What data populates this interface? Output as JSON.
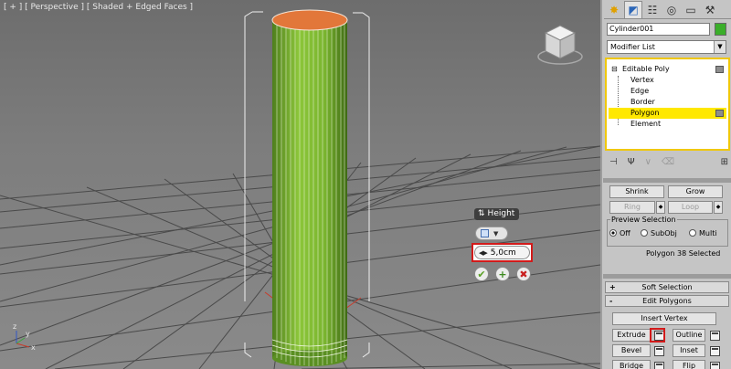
{
  "viewport": {
    "label": "[ + ] [ Perspective ] [ Shaded + Edged Faces ]",
    "axes": {
      "x": "x",
      "y": "y",
      "z": "z"
    }
  },
  "caddy": {
    "title": "Height",
    "value": "5,0cm",
    "mode_icon": "extrude-mode-icon",
    "ok_glyph": "✔",
    "apply_glyph": "+",
    "cancel_glyph": "✖"
  },
  "panel": {
    "tabs": [
      {
        "icon": "create-icon",
        "glyph": "✸"
      },
      {
        "icon": "modify-icon",
        "glyph": "◩"
      },
      {
        "icon": "hierarchy-icon",
        "glyph": "☷"
      },
      {
        "icon": "motion-icon",
        "glyph": "◎"
      },
      {
        "icon": "display-icon",
        "glyph": "▭"
      },
      {
        "icon": "utilities-icon",
        "glyph": "⚒"
      }
    ],
    "object_name": "Cylinder001",
    "object_color": "#3aae2a",
    "modifier_list": "Modifier List",
    "stack": {
      "root": "Editable Poly",
      "subobjects": [
        "Vertex",
        "Edge",
        "Border",
        "Polygon",
        "Element"
      ],
      "selected": "Polygon"
    },
    "selection": {
      "shrink": "Shrink",
      "grow": "Grow",
      "ring": "Ring",
      "loop": "Loop",
      "preview_title": "Preview Selection",
      "preview_options": [
        "Off",
        "SubObj",
        "Multi"
      ],
      "preview_selected": "Off",
      "status": "Polygon 38 Selected"
    },
    "soft_selection": {
      "title": "Soft Selection",
      "toggle": "+"
    },
    "edit_polygons": {
      "title": "Edit Polygons",
      "toggle": "-",
      "insert_vertex": "Insert Vertex",
      "extrude": "Extrude",
      "outline": "Outline",
      "bevel": "Bevel",
      "inset": "Inset",
      "bridge": "Bridge",
      "flip": "Flip"
    }
  }
}
